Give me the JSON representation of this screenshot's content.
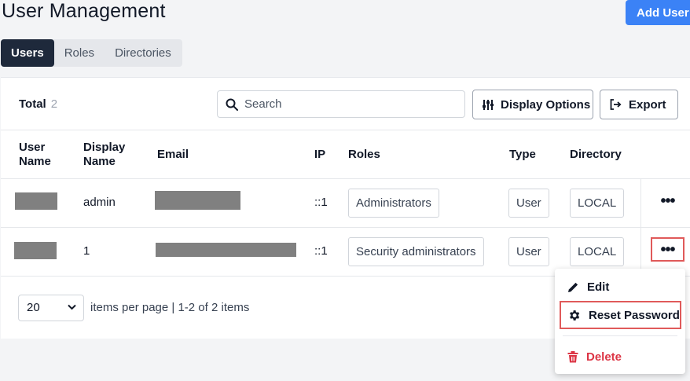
{
  "header": {
    "title": "User Management",
    "add_user_label": "Add User"
  },
  "tabs": [
    {
      "label": "Users",
      "active": true
    },
    {
      "label": "Roles",
      "active": false
    },
    {
      "label": "Directories",
      "active": false
    }
  ],
  "toolbar": {
    "total_label": "Total",
    "total_count": "2",
    "search_placeholder": "Search",
    "display_options_label": "Display Options",
    "export_label": "Export"
  },
  "table": {
    "headers": {
      "user_name_line1": "User",
      "user_name_line2": "Name",
      "display_name_line1": "Display",
      "display_name_line2": "Name",
      "email": "Email",
      "ip": "IP",
      "roles": "Roles",
      "type": "Type",
      "directory": "Directory"
    },
    "rows": [
      {
        "display_name": "admin",
        "ip": "::1",
        "role": "Administrators",
        "type": "User",
        "directory": "LOCAL"
      },
      {
        "display_name": "1",
        "ip": "::1",
        "role": "Security administrators",
        "type": "User",
        "directory": "LOCAL"
      }
    ],
    "actions_glyph": "•••"
  },
  "pagination": {
    "page_size": "20",
    "summary": "items per page | 1-2 of 2 items"
  },
  "context_menu": {
    "edit_label": "Edit",
    "reset_password_label": "Reset Password",
    "delete_label": "Delete"
  },
  "colors": {
    "primary": "#3b82f6",
    "active_tab": "#1e293b",
    "danger": "#dc3545",
    "highlight": "#e05a5a"
  },
  "icons": [
    "search-icon",
    "sliders-icon",
    "export-icon",
    "chevron-down-icon",
    "pencil-icon",
    "gear-icon",
    "trash-icon"
  ]
}
